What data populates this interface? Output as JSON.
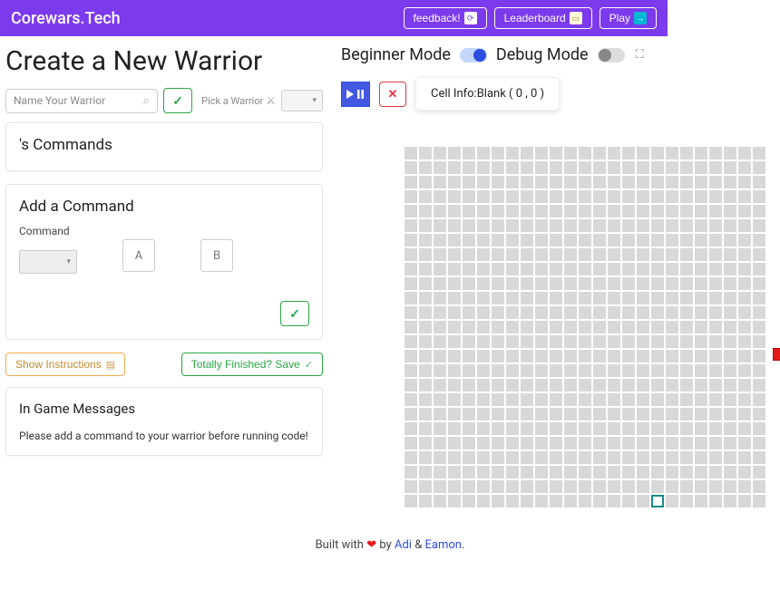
{
  "header": {
    "brand": "Corewars.Tech",
    "feedback_label": "feedback!",
    "leaderboard_label": "Leaderboard",
    "play_label": "Play"
  },
  "page": {
    "title": "Create a New Warrior",
    "name_placeholder": "Name Your Warrior",
    "pick_label": "Pick a Warrior"
  },
  "commands_card": {
    "title": "'s Commands"
  },
  "add_command": {
    "title": "Add a Command",
    "command_label": "Command",
    "a_label": "A",
    "b_label": "B"
  },
  "actions": {
    "show_instructions": "Show Instructions",
    "save": "Totally Finished? Save"
  },
  "messages": {
    "title": "In Game Messages",
    "body": "Please add a command to your warrior before running code!"
  },
  "modes": {
    "beginner": "Beginner Mode",
    "debug": "Debug Mode"
  },
  "cell_info": {
    "prefix": "Cell Info:",
    "value": "Blank ( 0 , 0 )"
  },
  "footer": {
    "built": "Built with",
    "by": "by",
    "amp": "&",
    "adi": "Adi",
    "eamon": "Eamon",
    "period": "."
  },
  "grid": {
    "cols": 25,
    "rows": 25
  }
}
